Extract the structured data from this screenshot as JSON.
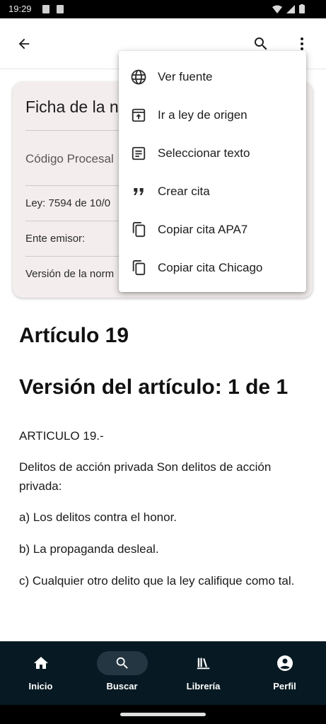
{
  "status_bar": {
    "time": "19:29"
  },
  "card": {
    "title": "Ficha de la n",
    "rows": [
      "Código Procesal",
      "Ley: 7594 de 10/0",
      "Ente emisor:",
      "Versión de la norm"
    ]
  },
  "article": {
    "heading": "Artículo 19",
    "version_heading": "Versión del artículo: 1 de 1",
    "paragraphs": [
      "ARTICULO 19.-",
      "Delitos de acción privada Son delitos de acción privada:",
      "a) Los delitos contra el honor.",
      "b) La propaganda desleal.",
      "c) Cualquier otro delito que la ley califique como tal."
    ]
  },
  "menu": {
    "items": [
      {
        "label": "Ver fuente",
        "icon": "globe-icon"
      },
      {
        "label": "Ir a ley de origen",
        "icon": "open-in-icon"
      },
      {
        "label": "Seleccionar texto",
        "icon": "select-text-icon"
      },
      {
        "label": "Crear cita",
        "icon": "quote-icon"
      },
      {
        "label": "Copiar cita APA7",
        "icon": "copy-icon"
      },
      {
        "label": "Copiar cita Chicago",
        "icon": "copy-icon"
      }
    ]
  },
  "bottom_nav": {
    "items": [
      {
        "label": "Inicio",
        "icon": "home-icon"
      },
      {
        "label": "Buscar",
        "icon": "search-icon"
      },
      {
        "label": "Librería",
        "icon": "library-icon"
      },
      {
        "label": "Perfil",
        "icon": "profile-icon"
      }
    ],
    "active": "Buscar"
  },
  "colors": {
    "nav_background": "#071a23",
    "nav_active_pill": "#243641",
    "card_background": "#f3eeed"
  }
}
